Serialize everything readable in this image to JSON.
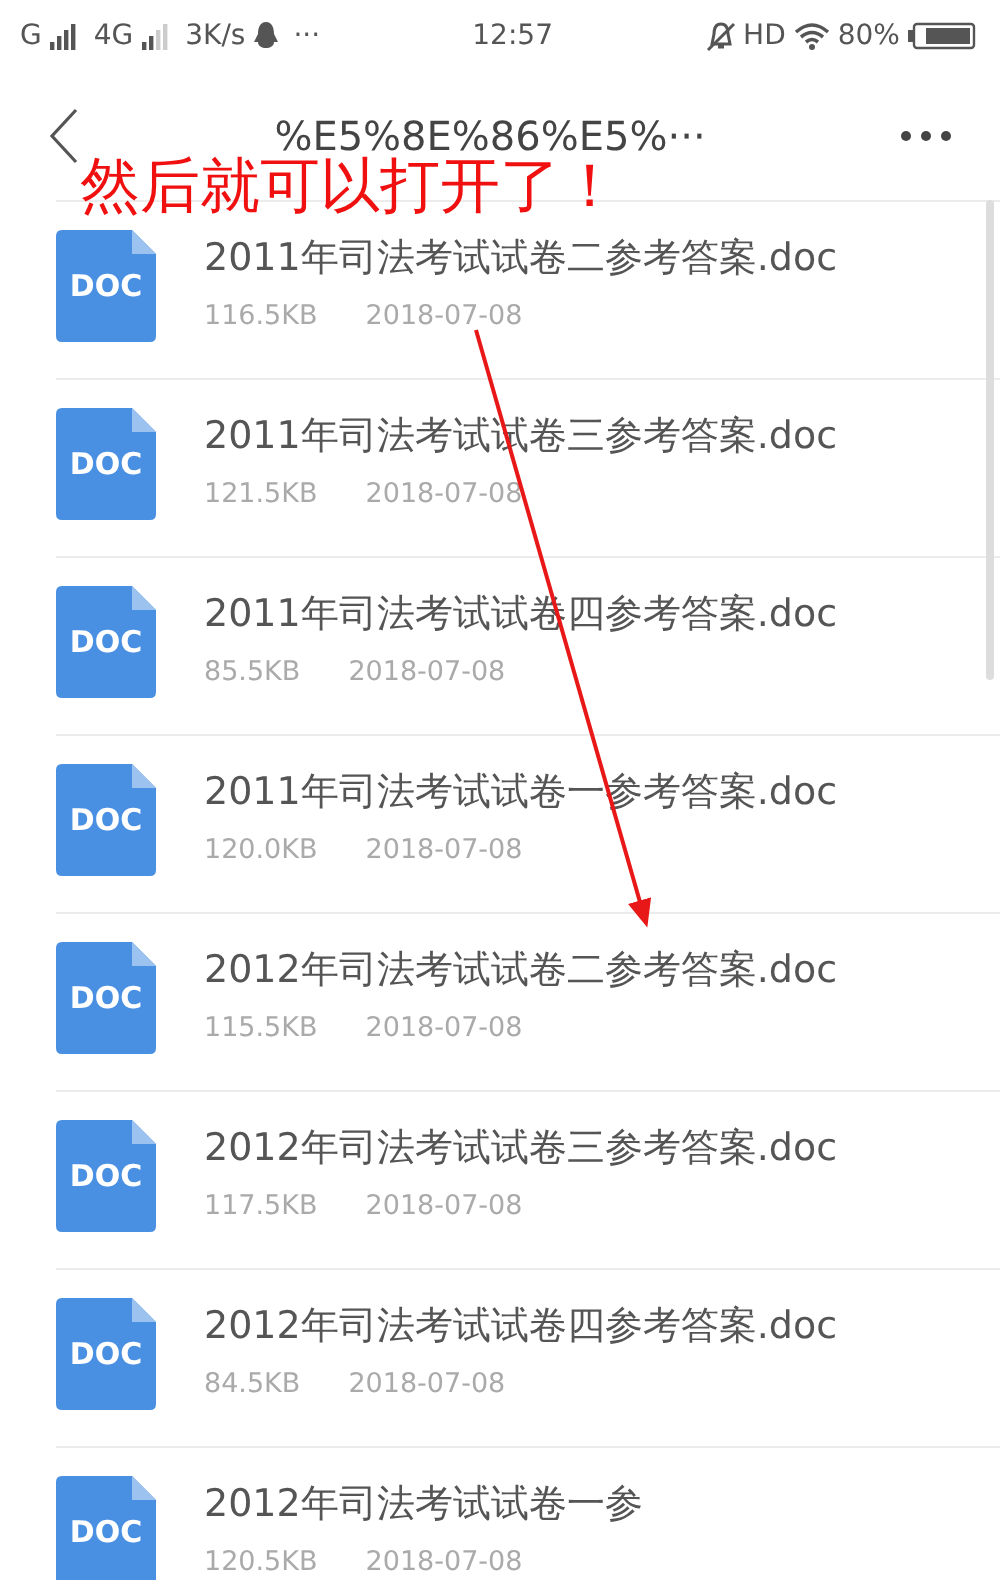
{
  "status_bar": {
    "carrier_1": "G",
    "carrier_2": "4G",
    "speed": "3K/s",
    "more": "···",
    "time": "12:57",
    "hd": "HD",
    "battery": "80%"
  },
  "title_bar": {
    "title": "%E5%8E%86%E5%···"
  },
  "annotation": {
    "text": "然后就可以打开了！"
  },
  "files": [
    {
      "badge": "DOC",
      "name": "2011年司法考试试卷二参考答案.doc",
      "size": "116.5KB",
      "date": "2018-07-08"
    },
    {
      "badge": "DOC",
      "name": "2011年司法考试试卷三参考答案.doc",
      "size": "121.5KB",
      "date": "2018-07-08"
    },
    {
      "badge": "DOC",
      "name": "2011年司法考试试卷四参考答案.doc",
      "size": "85.5KB",
      "date": "2018-07-08"
    },
    {
      "badge": "DOC",
      "name": "2011年司法考试试卷一参考答案.doc",
      "size": "120.0KB",
      "date": "2018-07-08"
    },
    {
      "badge": "DOC",
      "name": "2012年司法考试试卷二参考答案.doc",
      "size": "115.5KB",
      "date": "2018-07-08"
    },
    {
      "badge": "DOC",
      "name": "2012年司法考试试卷三参考答案.doc",
      "size": "117.5KB",
      "date": "2018-07-08"
    },
    {
      "badge": "DOC",
      "name": "2012年司法考试试卷四参考答案.doc",
      "size": "84.5KB",
      "date": "2018-07-08"
    },
    {
      "badge": "DOC",
      "name": "2012年司法考试试卷一参",
      "size": "120.5KB",
      "date": "2018-07-08"
    }
  ]
}
